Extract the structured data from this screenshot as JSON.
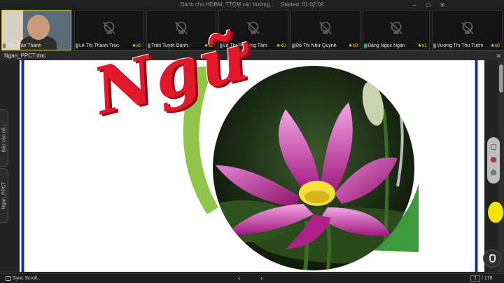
{
  "meeting": {
    "title": "Dành cho HDBM, TTCM các trường...",
    "started_label": "Started: 01:02:08"
  },
  "participants": [
    {
      "name": "Trần Văn Thành",
      "count": ""
    },
    {
      "name": "Lê Thị Thanh Trúc",
      "count": "x0"
    },
    {
      "name": "Trần Tuyết Oanh",
      "count": "x0"
    },
    {
      "name": "Lê Thị Phương Tâm",
      "count": "x0"
    },
    {
      "name": "Đỗ Thị Như Quỳnh",
      "count": "x0"
    },
    {
      "name": "Đặng Ngọc Ngân",
      "count": "x1"
    },
    {
      "name": "Vương Thị Thu Tường",
      "count": "x0"
    }
  ],
  "document": {
    "filename": "Ngan_PPCT.doc",
    "art_text": "Ngữ"
  },
  "sidetabs": {
    "tab1": "Báo cáo nề...",
    "tab2": "Ngan_PPCT"
  },
  "bottom": {
    "sync_label": "Sync Scroll",
    "page_current": "1",
    "page_total": "/ 178",
    "prev_glyph": "‹",
    "next_glyph": "›"
  },
  "colors": {
    "accent_yellow": "#f1d000",
    "text_red": "#e3182a",
    "arc_green": "#6fb43a",
    "rule_blue": "#1f2b7a"
  },
  "icons": [
    "camera-off-icon",
    "mic-icon",
    "star-icon",
    "close-icon",
    "minimize-icon",
    "maximize-icon",
    "pen-icon",
    "person-icon",
    "chevron-left-icon",
    "chevron-right-icon"
  ]
}
